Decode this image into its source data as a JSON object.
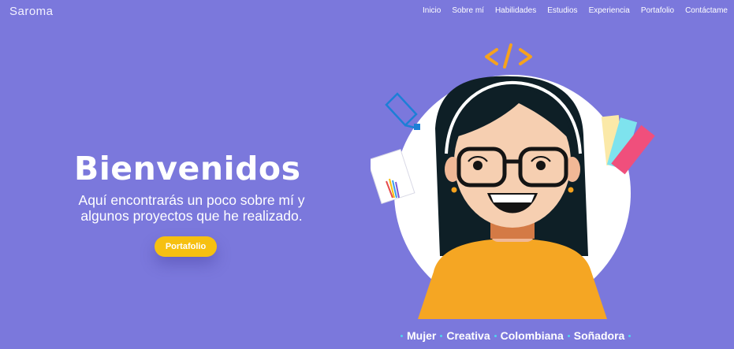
{
  "brand": {
    "logo": "Saroma"
  },
  "nav": {
    "items": [
      "Inicio",
      "Sobre mí",
      "Habilidades",
      "Estudios",
      "Experiencia",
      "Portafolio",
      "Contáctame"
    ]
  },
  "hero": {
    "title": "Bienvenidos",
    "subtitle": "Aquí encontrarás un poco sobre mí y algunos proyectos que he realizado.",
    "button": "Portafolio"
  },
  "tags": [
    "Mujer",
    "Creativa",
    "Colombiana",
    "Soñadora"
  ],
  "colors": {
    "background": "#7b78dc",
    "accent": "#f6c011",
    "tag_dot": "#4fd6ef"
  },
  "icons": [
    "code-brackets-icon",
    "pen-tool-icon",
    "notebook-icon",
    "color-palette-icon"
  ]
}
